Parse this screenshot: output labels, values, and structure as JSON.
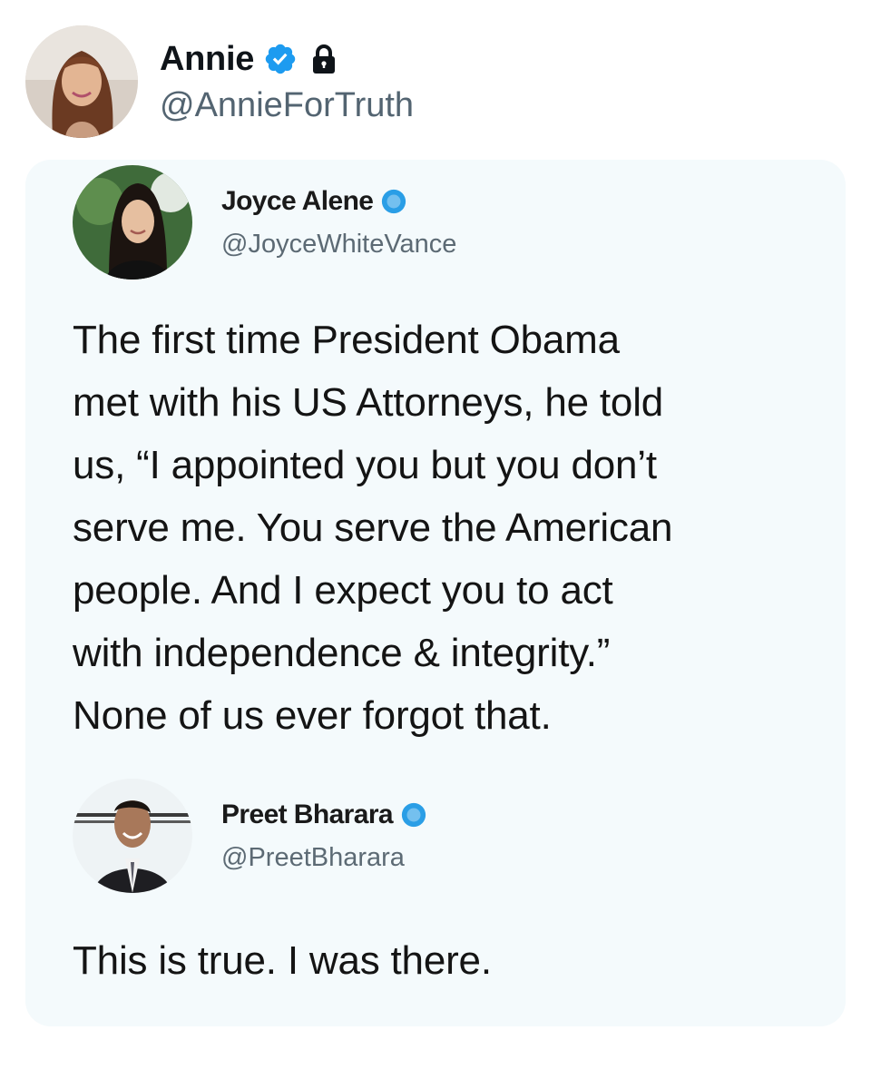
{
  "post": {
    "author_name": "Annie",
    "author_handle": "@AnnieForTruth",
    "verified_icon": "verified-badge-icon",
    "protected_icon": "lock-icon",
    "accent_color": "#1d9bf0"
  },
  "embedded_image": {
    "tweet": {
      "author_name": "Joyce Alene",
      "author_handle": "@JoyceWhiteVance",
      "verified_icon": "verified-badge-icon",
      "text": "The first time President Obama\nmet with his US Attorneys, he told\nus, “I appointed you but you don’t\nserve me. You serve the American\npeople. And I expect you to act\nwith independence & integrity.”\nNone of us ever forgot that."
    },
    "reply": {
      "author_name": "Preet Bharara",
      "author_handle": "@PreetBharara",
      "verified_icon": "verified-badge-icon",
      "text": "This is true. I was there."
    }
  }
}
